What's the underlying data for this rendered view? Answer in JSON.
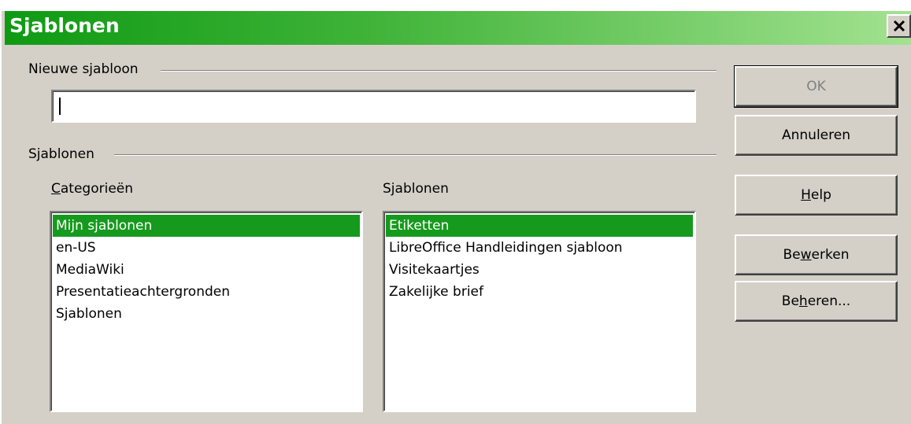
{
  "window": {
    "title": "Sjablonen"
  },
  "new_template": {
    "section_label": "Nieuwe sjabloon",
    "name_value": ""
  },
  "templates_section": {
    "section_label": "Sjablonen",
    "categories_label_parts": [
      "",
      "C",
      "ategorieën"
    ],
    "templates_label_parts": [
      "S",
      "j",
      "ablonen"
    ],
    "categories": [
      {
        "label": "Mijn sjablonen",
        "selected": true
      },
      {
        "label": "en-US",
        "selected": false
      },
      {
        "label": "MediaWiki",
        "selected": false
      },
      {
        "label": "Presentatieachtergronden",
        "selected": false
      },
      {
        "label": "Sjablonen",
        "selected": false
      }
    ],
    "templates": [
      {
        "label": "Etiketten",
        "selected": true
      },
      {
        "label": "LibreOffice Handleidingen sjabloon",
        "selected": false
      },
      {
        "label": "Visitekaartjes",
        "selected": false
      },
      {
        "label": "Zakelijke brief",
        "selected": false
      }
    ]
  },
  "buttons": {
    "ok": "OK",
    "cancel": "Annuleren",
    "help_parts": [
      "",
      "H",
      "elp"
    ],
    "edit_parts": [
      "Be",
      "w",
      "erken"
    ],
    "manage_parts": [
      "Be",
      "h",
      "eren..."
    ]
  },
  "colors": {
    "selection": "#169a1d",
    "titlebar_start": "#0f9a13",
    "titlebar_end": "#a3e290",
    "dialog_bg": "#d4d0c8"
  },
  "icons": {
    "close": "close-icon"
  }
}
